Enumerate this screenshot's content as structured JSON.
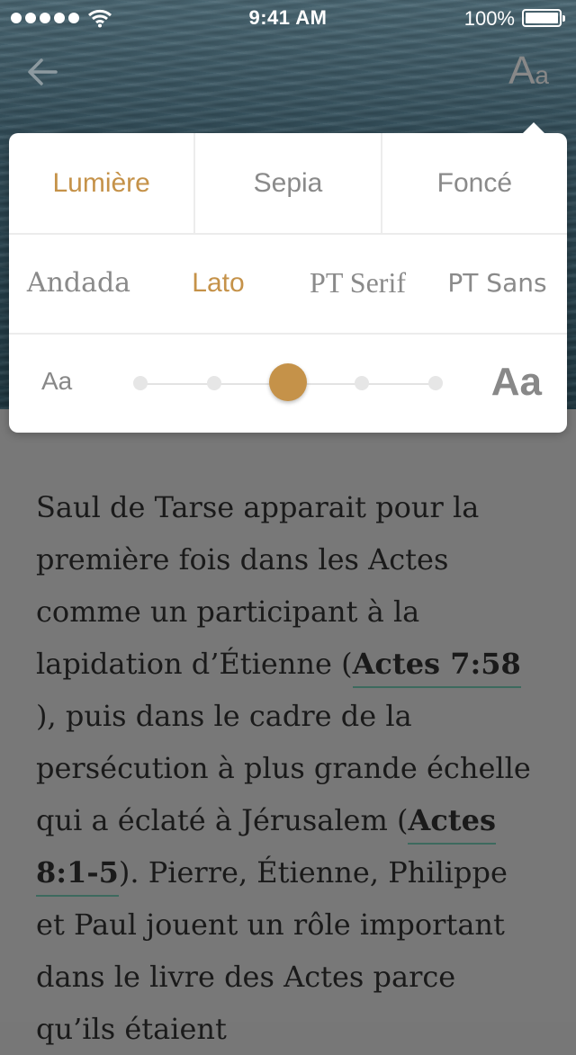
{
  "status_bar": {
    "time": "9:41 AM",
    "battery_percent": "100%",
    "icons": [
      "signal-dots-icon",
      "wifi-icon",
      "battery-icon"
    ]
  },
  "nav": {
    "back_icon": "arrow-left-icon",
    "font_settings_label_big": "A",
    "font_settings_label_small": "a"
  },
  "reader_settings": {
    "themes": [
      {
        "label": "Lumière",
        "active": true
      },
      {
        "label": "Sepia",
        "active": false
      },
      {
        "label": "Foncé",
        "active": false
      }
    ],
    "fonts": [
      {
        "label": "Andada",
        "active": false
      },
      {
        "label": "Lato",
        "active": true
      },
      {
        "label": "PT Serif",
        "active": false
      },
      {
        "label": "PT Sans",
        "active": false
      }
    ],
    "text_size": {
      "small_label": "Aa",
      "large_label": "Aa",
      "steps": 5,
      "selected_step": 3
    },
    "accent_color": "#c59249"
  },
  "article": {
    "part1": "Saul de Tarse apparait pour la première fois dans les Actes comme un participant à la lapidation d’Étienne (",
    "ref1": "Actes 7:58",
    "part2": " ), puis dans le cadre de la persécution à plus grande échelle qui a éclaté à Jérusalem (",
    "ref2": "Actes 8:1-5",
    "part3": "). Pierre, Étienne, Philippe et Paul jouent un rôle important dans le livre des Actes parce qu’ils étaient"
  }
}
